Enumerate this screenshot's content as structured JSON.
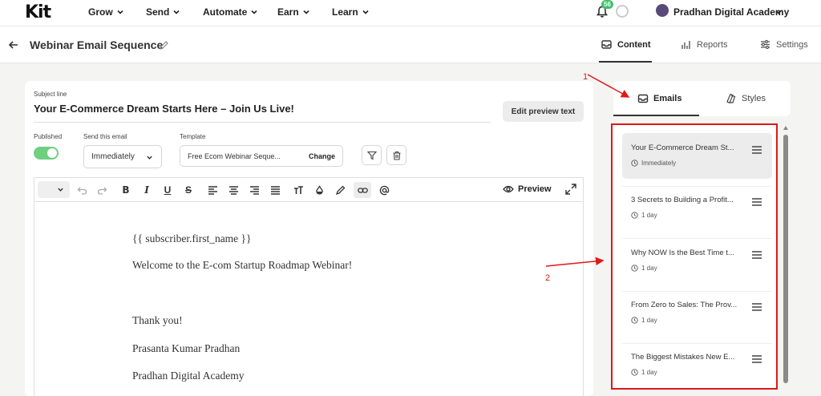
{
  "app": {
    "logo": "Kit"
  },
  "topnav": {
    "items": [
      {
        "label": "Grow"
      },
      {
        "label": "Send"
      },
      {
        "label": "Automate"
      },
      {
        "label": "Earn"
      },
      {
        "label": "Learn"
      }
    ],
    "notification_count": "56",
    "account_name": "Pradhan Digital Academy"
  },
  "header": {
    "sequence_title": "Webinar Email Sequence",
    "tabs": [
      {
        "label": "Content",
        "active": true
      },
      {
        "label": "Reports",
        "active": false
      },
      {
        "label": "Settings",
        "active": false
      }
    ]
  },
  "editor": {
    "subject_label": "Subject line",
    "subject_value": "Your E-Commerce Dream Starts Here – Join Us Live!",
    "edit_preview_label": "Edit preview text",
    "published_label": "Published",
    "published_on": true,
    "send_label": "Send this email",
    "send_value": "Immediately",
    "template_label": "Template",
    "template_value": "Free Ecom Webinar Seque...",
    "template_change": "Change",
    "toolbar_preview": "Preview",
    "body_lines": [
      "{{ subscriber.first_name }}",
      "Welcome to the E-com Startup Roadmap Webinar!",
      "Thank you!",
      "Prasanta Kumar Pradhan",
      "Pradhan Digital Academy"
    ]
  },
  "right_panel": {
    "tabs": [
      {
        "label": "Emails",
        "active": true
      },
      {
        "label": "Styles",
        "active": false
      }
    ],
    "emails": [
      {
        "title": "Your E-Commerce Dream St...",
        "delay": "Immediately",
        "selected": true
      },
      {
        "title": "3 Secrets to Building a Profit...",
        "delay": "1 day",
        "selected": false
      },
      {
        "title": "Why NOW Is the Best Time t...",
        "delay": "1 day",
        "selected": false
      },
      {
        "title": "From Zero to Sales: The Prov...",
        "delay": "1 day",
        "selected": false
      },
      {
        "title": "The Biggest Mistakes New E...",
        "delay": "1 day",
        "selected": false
      }
    ]
  },
  "annotations": {
    "label_1": "1",
    "label_2": "2",
    "color": "#e01818"
  },
  "colors": {
    "toggle_on": "#6fcf7f",
    "badge": "#3fbf6a"
  }
}
